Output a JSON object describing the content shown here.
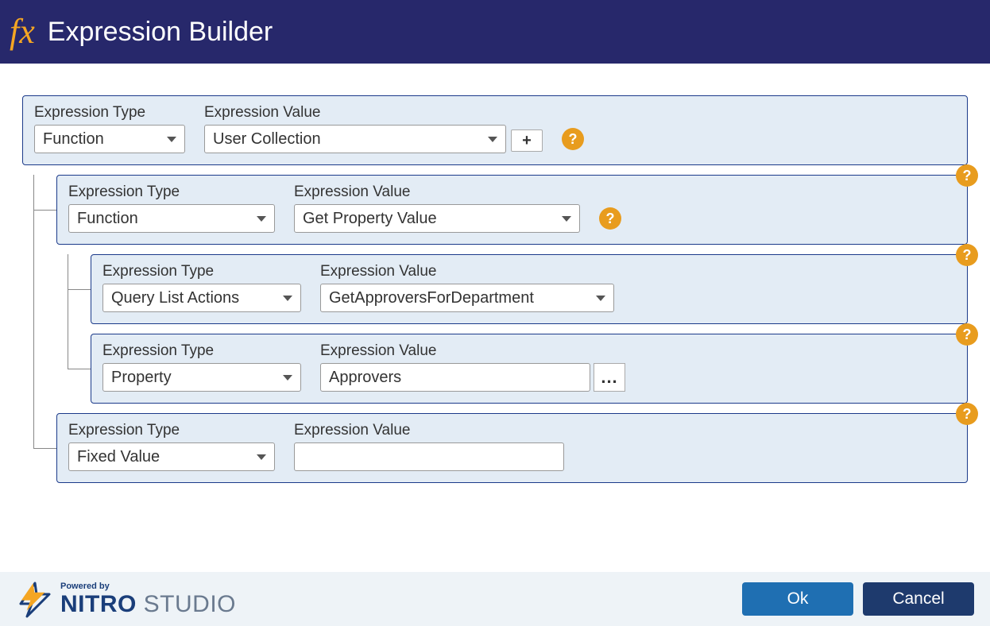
{
  "header": {
    "icon_label": "fx",
    "title": "Expression Builder"
  },
  "labels": {
    "expr_type": "Expression Type",
    "expr_value": "Expression Value",
    "help": "?",
    "plus": "+",
    "ellipsis": "..."
  },
  "rows": {
    "root": {
      "type": "Function",
      "value": "User Collection"
    },
    "child1": {
      "type": "Function",
      "value": "Get Property Value"
    },
    "grandchild1": {
      "type": "Query List Actions",
      "value": "GetApproversForDepartment"
    },
    "grandchild2": {
      "type": "Property",
      "value": "Approvers"
    },
    "child2": {
      "type": "Fixed Value",
      "value": ""
    }
  },
  "footer": {
    "powered_by": "Powered by",
    "brand": "NITRO",
    "studio": " STUDIO",
    "ok": "Ok",
    "cancel": "Cancel"
  }
}
